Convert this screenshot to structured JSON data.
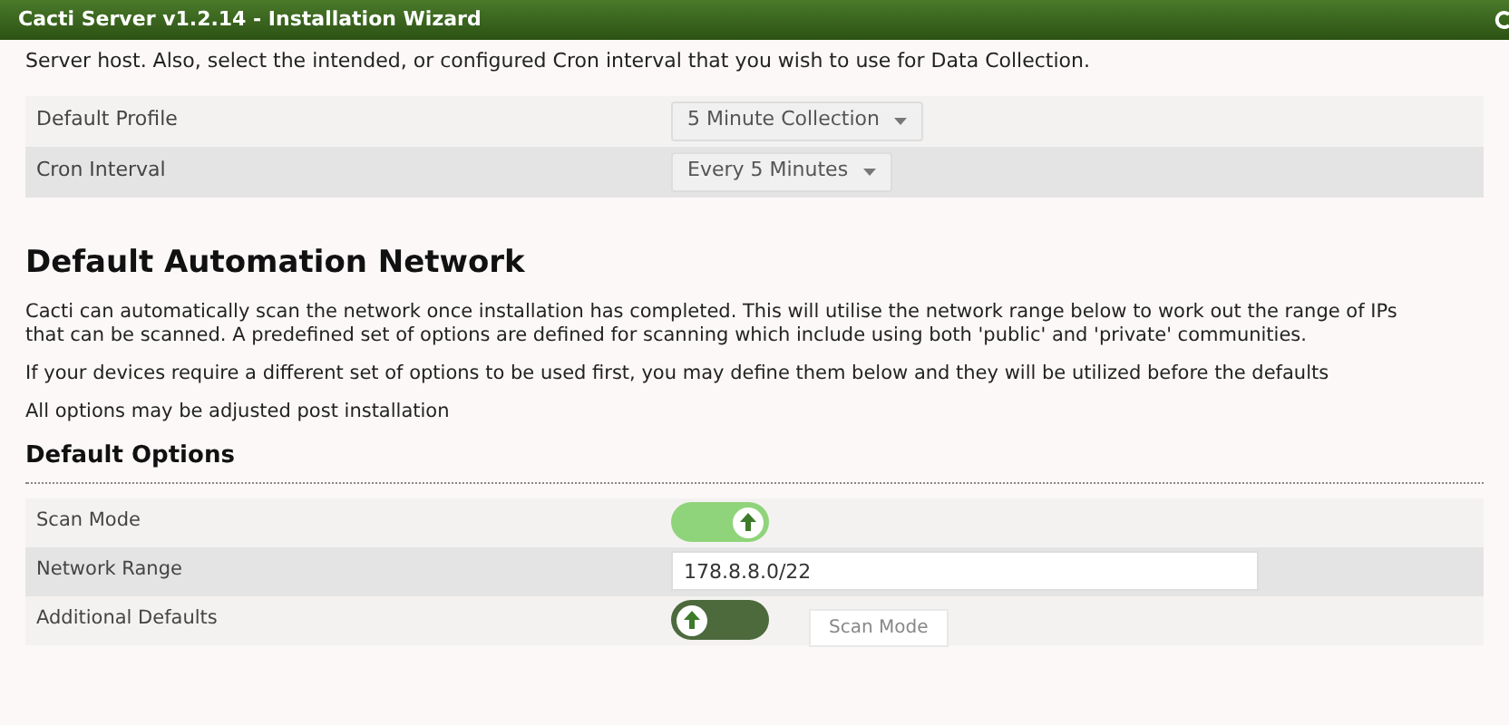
{
  "window": {
    "title": "Cacti Server v1.2.14 - Installation Wizard"
  },
  "intro": "Server host. Also, select the intended, or configured Cron interval that you wish to use for Data Collection.",
  "profile_rows": [
    {
      "label": "Default Profile",
      "value": "5 Minute Collection"
    },
    {
      "label": "Cron Interval",
      "value": "Every 5 Minutes"
    }
  ],
  "section": {
    "title": "Default Automation Network",
    "paragraphs": [
      "Cacti can automatically scan the network once installation has completed. This will utilise the network range below to work out the range of IPs that can be scanned. A predefined set of options are defined for scanning which include using both 'public' and 'private' communities.",
      "If your devices require a different set of options to be used first, you may define them below and they will be utilized before the defaults",
      "All options may be adjusted post installation"
    ]
  },
  "options": {
    "title": "Default Options",
    "rows": [
      {
        "kind": "toggle",
        "label": "Scan Mode",
        "on": true
      },
      {
        "kind": "text",
        "label": "Network Range",
        "value": "178.8.8.0/22"
      },
      {
        "kind": "toggle",
        "label": "Additional Defaults",
        "on": false
      }
    ]
  },
  "tooltip": "Scan Mode"
}
